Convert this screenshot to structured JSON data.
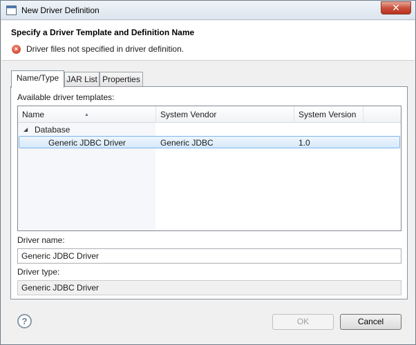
{
  "window": {
    "title": "New Driver Definition",
    "close_glyph": "✕"
  },
  "banner": {
    "title": "Specify a Driver Template and Definition Name",
    "error_message": "Driver files not specified in driver definition.",
    "error_icon": "error-icon"
  },
  "tabs": [
    {
      "label": "Name/Type",
      "active": true
    },
    {
      "label": "JAR List",
      "active": false
    },
    {
      "label": "Properties",
      "active": false
    }
  ],
  "templates": {
    "label": "Available driver templates:",
    "columns": [
      "Name",
      "System Vendor",
      "System Version"
    ],
    "category": {
      "name": "Database",
      "expanded_glyph": "◢"
    },
    "rows": [
      {
        "name": "Generic JDBC Driver",
        "vendor": "Generic JDBC",
        "version": "1.0",
        "selected": true
      }
    ]
  },
  "driver_name": {
    "label": "Driver name:",
    "value": "Generic JDBC Driver"
  },
  "driver_type": {
    "label": "Driver type:",
    "value": "Generic JDBC Driver"
  },
  "buttons": {
    "ok": "OK",
    "cancel": "Cancel",
    "help": "?"
  },
  "colors": {
    "selection": "#d6e9fa",
    "error": "#c8311f",
    "close": "#c9503c"
  }
}
